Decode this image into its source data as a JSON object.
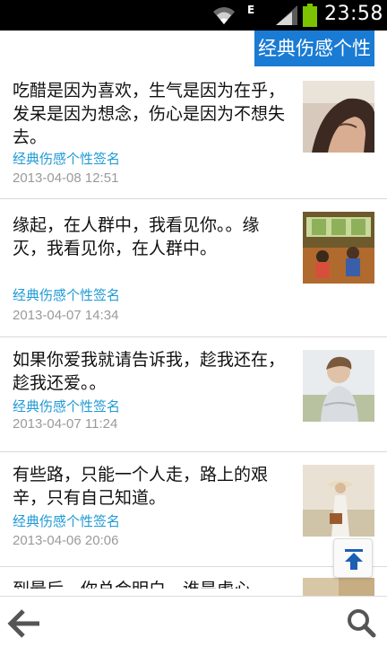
{
  "status_bar": {
    "time": "23:58",
    "network_type": "E",
    "icons": [
      "wifi-icon",
      "signal-icon",
      "battery-icon"
    ],
    "battery_color": "#7cc400"
  },
  "header": {
    "title": "经典伤感个性",
    "accent_color": "#1a7bd4"
  },
  "items": [
    {
      "text": "吃醋是因为喜欢，生气是因为在乎，发呆是因为想念，伤心是因为不想失去。",
      "category": "经典伤感个性签名",
      "date": "2013-04-08 12:51",
      "thumb": "woman-with-hair-photo"
    },
    {
      "text": "缘起，在人群中，我看见你。。缘灭，我看见你，在人群中。",
      "category": "经典伤感个性签名",
      "date": "2013-04-07 14:34",
      "thumb": "bus-interior-illustration"
    },
    {
      "text": "如果你爱我就请告诉我，趁我还在， 趁我还爱。。",
      "category": "经典伤感个性签名",
      "date": "2013-04-07 11:24",
      "thumb": "boy-portrait-photo"
    },
    {
      "text": "有些路，只能一个人走，路上的艰辛，只有自己知道。",
      "category": "经典伤感个性签名",
      "date": "2013-04-06 20:06",
      "thumb": "girl-with-hat-photo"
    },
    {
      "text": "到最后，你总会明白，谁是虚心",
      "thumb": "partial-photo"
    }
  ],
  "controls": {
    "scroll_top_icon": "arrow-up-to-line-icon",
    "back_icon": "arrow-left-icon",
    "search_icon": "search-icon"
  },
  "colors": {
    "category_text": "#1f9ad6",
    "date_text": "#9a9a9a",
    "divider": "#d9d9d9"
  }
}
